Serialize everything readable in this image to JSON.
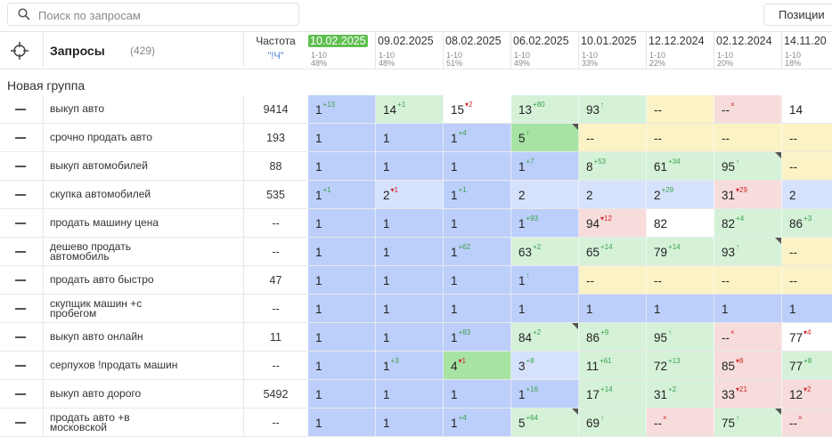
{
  "search": {
    "placeholder": "Поиск по запросам",
    "value": ""
  },
  "positions_button": "Позиции",
  "header": {
    "title": "Запросы",
    "count": "(429)",
    "freq_label": "Частота",
    "freq_sub": "\"!Ч\""
  },
  "dates": [
    {
      "date": "10.02.2025",
      "range": "1-10",
      "pct": "48%",
      "active": true
    },
    {
      "date": "09.02.2025",
      "range": "1-10",
      "pct": "48%"
    },
    {
      "date": "08.02.2025",
      "range": "1-10",
      "pct": "51%"
    },
    {
      "date": "06.02.2025",
      "range": "1-10",
      "pct": "49%"
    },
    {
      "date": "10.01.2025",
      "range": "1-10",
      "pct": "33%"
    },
    {
      "date": "12.12.2024",
      "range": "1-10",
      "pct": "22%"
    },
    {
      "date": "02.12.2024",
      "range": "1-10",
      "pct": "20%"
    },
    {
      "date": "14.11.20",
      "range": "1-10",
      "pct": "18%"
    }
  ],
  "group_name": "Новая группа",
  "colors": {
    "blue": "#bccffa",
    "lightblue": "#d6e2fb",
    "green": "#d5f2d9",
    "bright_green": "#a7e3a3",
    "yellow": "#fbf2c5",
    "pink": "#f7dcdc",
    "white": "#ffffff",
    "active_date": "#5fbf4f"
  },
  "rows": [
    {
      "keyword": "выкуп авто",
      "freq": "9414",
      "cells": [
        {
          "v": "1",
          "d": "13",
          "dir": "up",
          "c": "blue"
        },
        {
          "v": "14",
          "d": "1",
          "dir": "up",
          "c": "green"
        },
        {
          "v": "15",
          "d": "2",
          "dir": "down",
          "c": "white"
        },
        {
          "v": "13",
          "d": "80",
          "dir": "up",
          "c": "green"
        },
        {
          "v": "93",
          "d": "↑",
          "dir": "up",
          "c": "green"
        },
        {
          "v": "--",
          "c": "yellow"
        },
        {
          "v": "--",
          "d": "×",
          "dir": "x",
          "c": "pink"
        },
        {
          "v": "14",
          "c": "white"
        }
      ]
    },
    {
      "keyword": "срочно продать авто",
      "freq": "193",
      "cells": [
        {
          "v": "1",
          "c": "blue"
        },
        {
          "v": "1",
          "c": "blue"
        },
        {
          "v": "1",
          "d": "4",
          "dir": "up",
          "c": "blue"
        },
        {
          "v": "5",
          "d": "↑",
          "dir": "up",
          "c": "bright_green",
          "corner": true
        },
        {
          "v": "--",
          "c": "yellow"
        },
        {
          "v": "--",
          "c": "yellow"
        },
        {
          "v": "--",
          "c": "yellow"
        },
        {
          "v": "--",
          "c": "yellow"
        }
      ]
    },
    {
      "keyword": "выкуп автомобилей",
      "freq": "88",
      "cells": [
        {
          "v": "1",
          "c": "blue"
        },
        {
          "v": "1",
          "c": "blue"
        },
        {
          "v": "1",
          "c": "blue"
        },
        {
          "v": "1",
          "d": "7",
          "dir": "up",
          "c": "blue"
        },
        {
          "v": "8",
          "d": "53",
          "dir": "up",
          "c": "green"
        },
        {
          "v": "61",
          "d": "34",
          "dir": "up",
          "c": "green"
        },
        {
          "v": "95",
          "d": "↑",
          "dir": "up",
          "c": "green",
          "corner": true
        },
        {
          "v": "--",
          "c": "yellow"
        }
      ]
    },
    {
      "keyword": "скупка автомобилей",
      "freq": "535",
      "cells": [
        {
          "v": "1",
          "d": "1",
          "dir": "up",
          "c": "blue"
        },
        {
          "v": "2",
          "d": "1",
          "dir": "down",
          "c": "lightblue"
        },
        {
          "v": "1",
          "d": "1",
          "dir": "up",
          "c": "blue"
        },
        {
          "v": "2",
          "c": "lightblue"
        },
        {
          "v": "2",
          "c": "lightblue"
        },
        {
          "v": "2",
          "d": "29",
          "dir": "up",
          "c": "lightblue"
        },
        {
          "v": "31",
          "d": "29",
          "dir": "down",
          "c": "pink"
        },
        {
          "v": "2",
          "c": "lightblue"
        }
      ]
    },
    {
      "keyword": "продать машину цена",
      "freq": "--",
      "cells": [
        {
          "v": "1",
          "c": "blue"
        },
        {
          "v": "1",
          "c": "blue"
        },
        {
          "v": "1",
          "c": "blue"
        },
        {
          "v": "1",
          "d": "93",
          "dir": "up",
          "c": "blue"
        },
        {
          "v": "94",
          "d": "12",
          "dir": "down",
          "c": "pink"
        },
        {
          "v": "82",
          "c": "white"
        },
        {
          "v": "82",
          "d": "4",
          "dir": "up",
          "c": "green"
        },
        {
          "v": "86",
          "d": "3",
          "dir": "up",
          "c": "green"
        }
      ]
    },
    {
      "keyword": "дешево продать автомобиль",
      "freq": "--",
      "cells": [
        {
          "v": "1",
          "c": "blue"
        },
        {
          "v": "1",
          "c": "blue"
        },
        {
          "v": "1",
          "d": "62",
          "dir": "up",
          "c": "blue"
        },
        {
          "v": "63",
          "d": "2",
          "dir": "up",
          "c": "green"
        },
        {
          "v": "65",
          "d": "14",
          "dir": "up",
          "c": "green"
        },
        {
          "v": "79",
          "d": "14",
          "dir": "up",
          "c": "green"
        },
        {
          "v": "93",
          "d": "↑",
          "dir": "up",
          "c": "green",
          "corner": true
        },
        {
          "v": "--",
          "c": "yellow"
        }
      ]
    },
    {
      "keyword": "продать авто быстро",
      "freq": "47",
      "cells": [
        {
          "v": "1",
          "c": "blue"
        },
        {
          "v": "1",
          "c": "blue"
        },
        {
          "v": "1",
          "c": "blue"
        },
        {
          "v": "1",
          "d": "↑",
          "dir": "up",
          "c": "blue"
        },
        {
          "v": "--",
          "c": "yellow"
        },
        {
          "v": "--",
          "c": "yellow"
        },
        {
          "v": "--",
          "c": "yellow"
        },
        {
          "v": "--",
          "c": "yellow"
        }
      ]
    },
    {
      "keyword": "скупщик машин +с пробегом",
      "freq": "--",
      "cells": [
        {
          "v": "1",
          "c": "blue"
        },
        {
          "v": "1",
          "c": "blue"
        },
        {
          "v": "1",
          "c": "blue"
        },
        {
          "v": "1",
          "c": "blue"
        },
        {
          "v": "1",
          "c": "blue"
        },
        {
          "v": "1",
          "c": "blue"
        },
        {
          "v": "1",
          "c": "blue"
        },
        {
          "v": "1",
          "c": "blue"
        }
      ]
    },
    {
      "keyword": "выкуп авто онлайн",
      "freq": "11",
      "cells": [
        {
          "v": "1",
          "c": "blue"
        },
        {
          "v": "1",
          "c": "blue"
        },
        {
          "v": "1",
          "d": "83",
          "dir": "up",
          "c": "blue"
        },
        {
          "v": "84",
          "d": "2",
          "dir": "up",
          "c": "green",
          "corner": true
        },
        {
          "v": "86",
          "d": "9",
          "dir": "up",
          "c": "green"
        },
        {
          "v": "95",
          "d": "↑",
          "dir": "up",
          "c": "green"
        },
        {
          "v": "--",
          "d": "×",
          "dir": "x",
          "c": "pink"
        },
        {
          "v": "77",
          "d": "4",
          "dir": "down",
          "c": "white"
        }
      ]
    },
    {
      "keyword": "серпухов !продать машин",
      "freq": "--",
      "cells": [
        {
          "v": "1",
          "c": "blue"
        },
        {
          "v": "1",
          "d": "3",
          "dir": "up",
          "c": "blue"
        },
        {
          "v": "4",
          "d": "1",
          "dir": "down",
          "c": "bright_green"
        },
        {
          "v": "3",
          "d": "8",
          "dir": "up",
          "c": "lightblue"
        },
        {
          "v": "11",
          "d": "61",
          "dir": "up",
          "c": "green"
        },
        {
          "v": "72",
          "d": "13",
          "dir": "up",
          "c": "green"
        },
        {
          "v": "85",
          "d": "8",
          "dir": "down",
          "c": "pink"
        },
        {
          "v": "77",
          "d": "8",
          "dir": "up",
          "c": "green"
        }
      ]
    },
    {
      "keyword": "выкуп авто дорого",
      "freq": "5492",
      "cells": [
        {
          "v": "1",
          "c": "blue"
        },
        {
          "v": "1",
          "c": "blue"
        },
        {
          "v": "1",
          "c": "blue"
        },
        {
          "v": "1",
          "d": "16",
          "dir": "up",
          "c": "blue"
        },
        {
          "v": "17",
          "d": "14",
          "dir": "up",
          "c": "green"
        },
        {
          "v": "31",
          "d": "2",
          "dir": "up",
          "c": "green"
        },
        {
          "v": "33",
          "d": "21",
          "dir": "down",
          "c": "pink"
        },
        {
          "v": "12",
          "d": "2",
          "dir": "down",
          "c": "pink"
        }
      ]
    },
    {
      "keyword": "продать авто +в московской",
      "freq": "--",
      "cells": [
        {
          "v": "1",
          "c": "blue"
        },
        {
          "v": "1",
          "c": "blue"
        },
        {
          "v": "1",
          "d": "4",
          "dir": "up",
          "c": "blue"
        },
        {
          "v": "5",
          "d": "64",
          "dir": "up",
          "c": "green",
          "corner": true
        },
        {
          "v": "69",
          "d": "↑",
          "dir": "up",
          "c": "green"
        },
        {
          "v": "--",
          "d": "×",
          "dir": "x",
          "c": "pink"
        },
        {
          "v": "75",
          "d": "↑",
          "dir": "up",
          "c": "green",
          "corner": true
        },
        {
          "v": "--",
          "d": "×",
          "dir": "x",
          "c": "pink"
        }
      ]
    }
  ]
}
